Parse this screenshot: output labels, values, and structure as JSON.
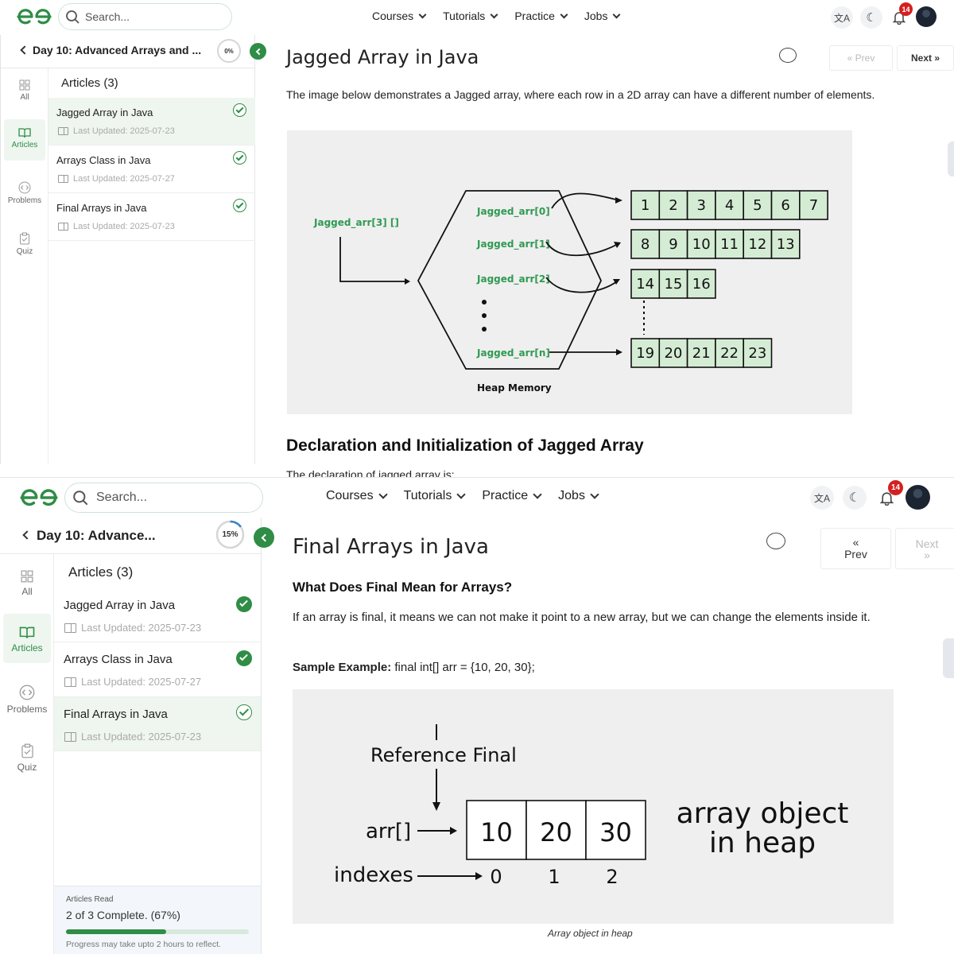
{
  "header": {
    "search_placeholder": "Search...",
    "nav": [
      "Courses",
      "Tutorials",
      "Practice",
      "Jobs"
    ],
    "notifications": "14"
  },
  "screen1": {
    "sidebar": {
      "title": "Day 10: Advanced Arrays and ...",
      "progress": "0%",
      "rail": [
        "All",
        "Articles",
        "Problems",
        "Quiz"
      ],
      "articles_heading": "Articles (3)",
      "articles": [
        {
          "title": "Jagged Array in Java",
          "updated": "Last Updated: 2025-07-23"
        },
        {
          "title": "Arrays Class in Java",
          "updated": "Last Updated: 2025-07-27"
        },
        {
          "title": "Final Arrays in Java",
          "updated": "Last Updated: 2025-07-23"
        }
      ]
    },
    "main": {
      "title": "Jagged Array in Java",
      "prev": "Prev",
      "next": "Next",
      "intro": "The image below demonstrates a Jagged array, where each row in a 2D array can have a different number of elements.",
      "diagram": {
        "ref_label": "Jagged_arr[3] []",
        "rows": [
          "Jagged_arr[0]",
          "Jagged_arr[1]",
          "Jagged_arr[2]",
          "Jagged_arr[n]"
        ],
        "row0": [
          "1",
          "2",
          "3",
          "4",
          "5",
          "6",
          "7"
        ],
        "row1": [
          "8",
          "9",
          "10",
          "11",
          "12",
          "13"
        ],
        "row2": [
          "14",
          "15",
          "16"
        ],
        "rown": [
          "19",
          "20",
          "21",
          "22",
          "23"
        ],
        "heap_label": "Heap Memory"
      },
      "h2": "Declaration and Initialization of Jagged Array",
      "cut_text": "The declaration of jagged array is:"
    }
  },
  "screen2": {
    "sidebar": {
      "title": "Day 10: Advance...",
      "progress": "15%",
      "progress_fraction": 0.15,
      "rail": [
        "All",
        "Articles",
        "Problems",
        "Quiz"
      ],
      "articles_heading": "Articles (3)",
      "articles": [
        {
          "title": "Jagged Array in Java",
          "updated": "Last Updated: 2025-07-23"
        },
        {
          "title": "Arrays Class in Java",
          "updated": "Last Updated: 2025-07-27"
        },
        {
          "title": "Final Arrays in Java",
          "updated": "Last Updated: 2025-07-23"
        }
      ],
      "read_label": "Articles Read",
      "read_count": "2 of 3 Complete. (67%)",
      "read_fraction": 0.67,
      "read_note": "Progress may take upto 2 hours to reflect."
    },
    "main": {
      "title": "Final Arrays in Java",
      "prev": "Prev",
      "next": "Next",
      "h3": "What Does Final Mean for Arrays?",
      "para": "If an array is final, it means we can not make it point to a new array, but we can change the elements inside it.",
      "sample_bold": "Sample Example:",
      "sample_code": " final int[] arr = {10, 20, 30};",
      "diagram": {
        "ref_final": "Reference Final",
        "arr": "arr[]",
        "values": [
          "10",
          "20",
          "30"
        ],
        "indexes_label": "indexes",
        "indexes": [
          "0",
          "1",
          "2"
        ],
        "obj_line1": "array object",
        "obj_line2": "in heap"
      },
      "caption": "Array object in heap"
    }
  },
  "colors": {
    "brand_green": "#2f8d46",
    "badge_red": "#d32020",
    "diagram_text_green": "#2f9a52",
    "cell_fill": "#d4ecd4"
  }
}
